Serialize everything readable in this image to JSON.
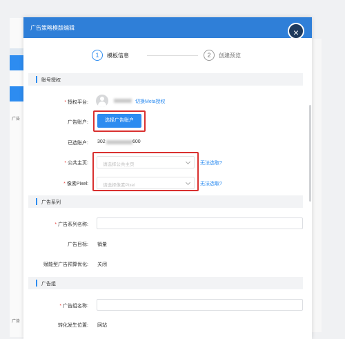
{
  "modal": {
    "title": "广告策略模版编辑",
    "close_symbol": "×"
  },
  "steps": [
    {
      "number": "1",
      "label": "模板信息"
    },
    {
      "number": "2",
      "label": "创建预览"
    }
  ],
  "background": {
    "side_text_1": "广告",
    "side_text_2": "广告"
  },
  "sections": {
    "account_auth": "账号授权",
    "ad_series": "广告系列",
    "ad_group": "广告组"
  },
  "form": {
    "auth_platform_label": "授权平台:",
    "switch_meta_link": "切换Meta授权",
    "ad_account_label": "广告账户:",
    "select_account_button": "选择广告账户",
    "selected_account_label": "已选账户:",
    "selected_account_prefix": "302",
    "selected_account_suffix": "600",
    "public_page_label": "公共主页:",
    "public_page_placeholder": "请选择公共主页",
    "public_page_help": "无法选取?",
    "pixel_label": "像素Pixel:",
    "pixel_placeholder": "请选择像素Pixel",
    "pixel_help": "无法选取?",
    "series_name_label": "广告系列名称:",
    "ad_goal_label": "广告目标:",
    "ad_goal_value": "销量",
    "budget_opt_label": "赋能型广告预算优化:",
    "budget_opt_value": "关闭",
    "group_name_label": "广告组名称:",
    "conversion_location_label": "转化发生位置:",
    "conversion_location_value": "网站"
  }
}
